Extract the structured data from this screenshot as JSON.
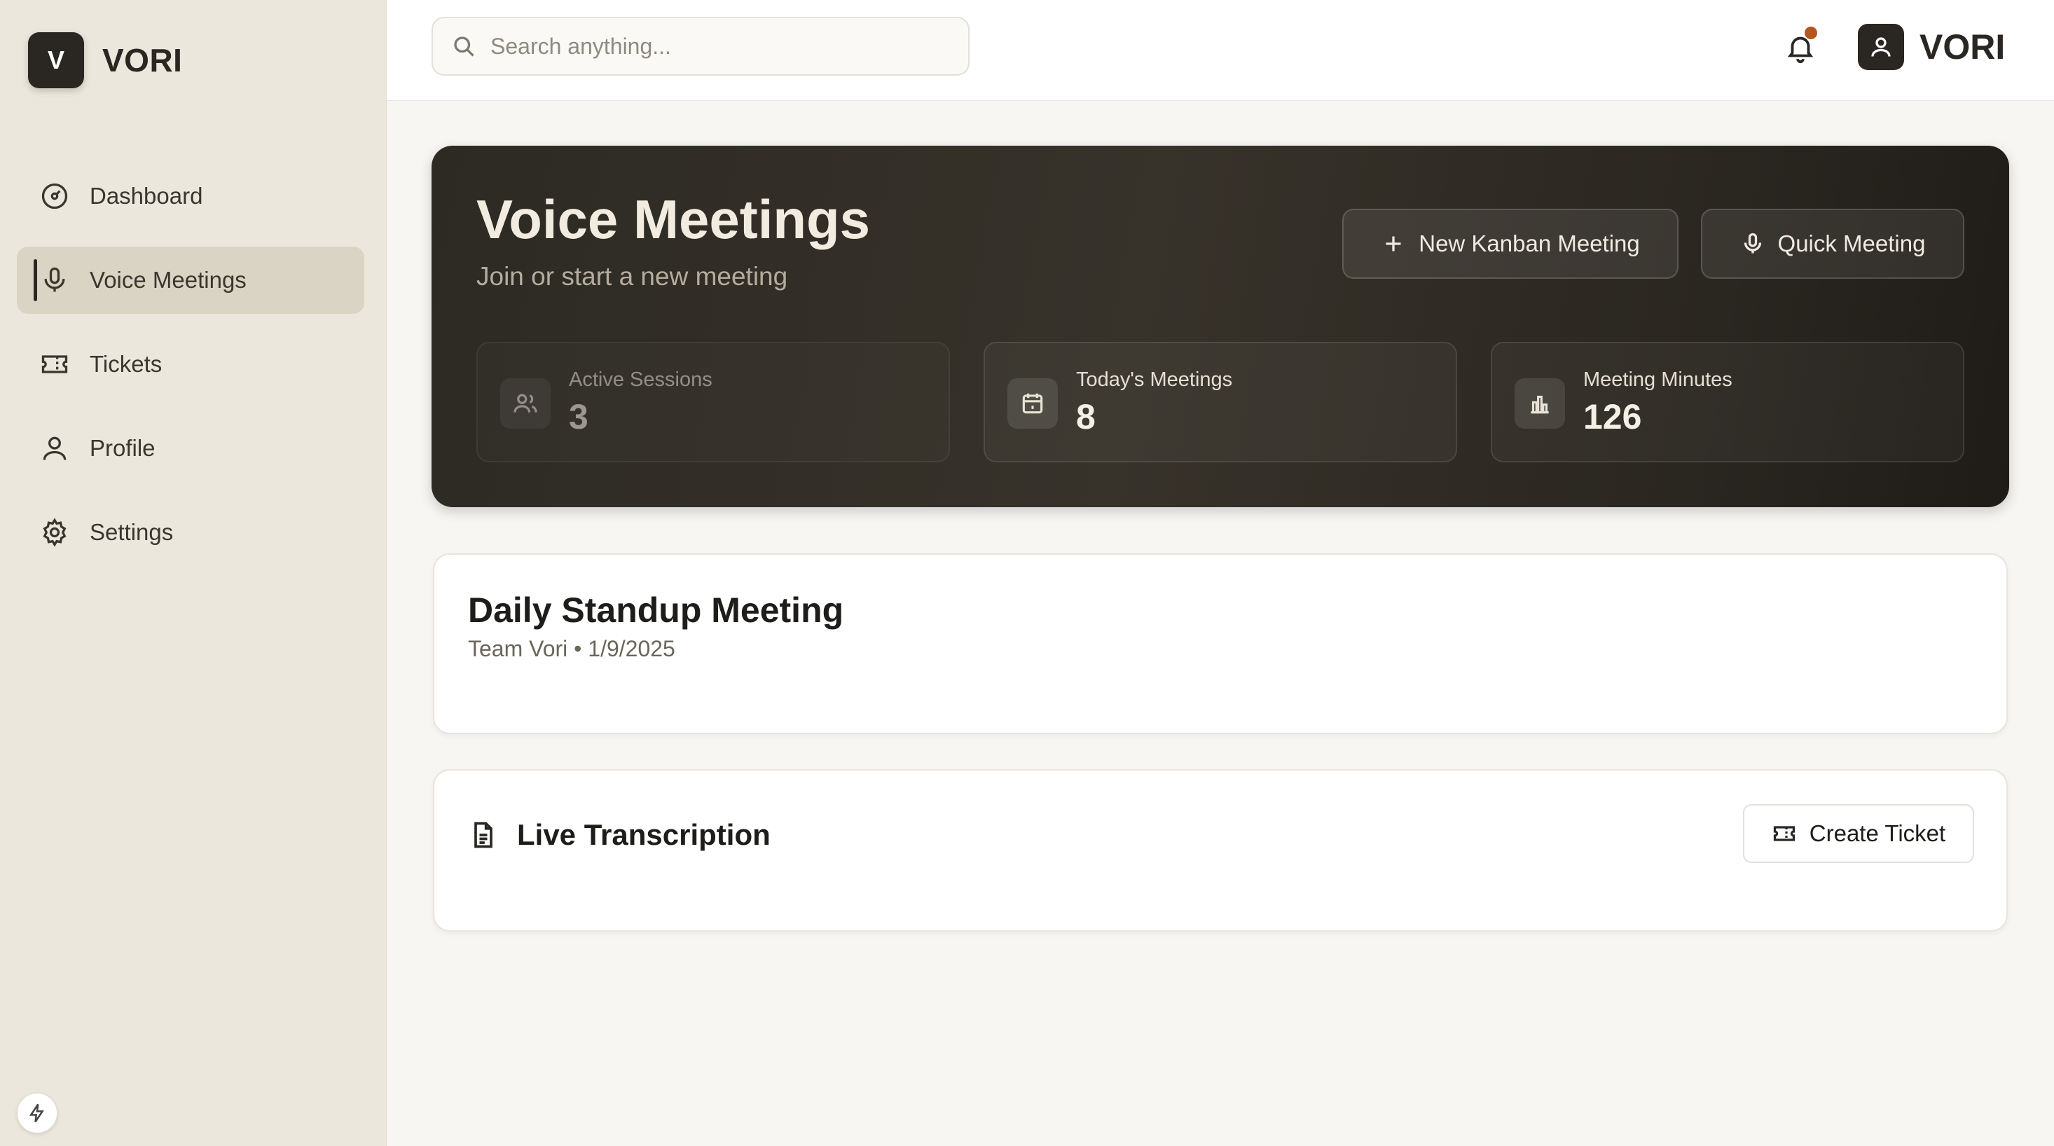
{
  "brand": {
    "initial": "V",
    "name": "VORI"
  },
  "sidebar": {
    "items": [
      {
        "label": "Dashboard",
        "icon": "dashboard-gauge-icon",
        "active": false
      },
      {
        "label": "Voice Meetings",
        "icon": "microphone-icon",
        "active": true
      },
      {
        "label": "Tickets",
        "icon": "ticket-icon",
        "active": false
      },
      {
        "label": "Profile",
        "icon": "user-icon",
        "active": false
      },
      {
        "label": "Settings",
        "icon": "gear-icon",
        "active": false
      }
    ],
    "footer_icon": "bolt-icon"
  },
  "header": {
    "search_placeholder": "Search anything...",
    "notification_icon": "bell-icon",
    "has_unread_notification": true,
    "user_name": "VORI"
  },
  "hero": {
    "title": "Voice Meetings",
    "subtitle": "Join or start a new meeting",
    "new_kanban_label": "New Kanban Meeting",
    "quick_meeting_label": "Quick Meeting",
    "stats": [
      {
        "label": "Active Sessions",
        "value": "3",
        "icon": "users-icon"
      },
      {
        "label": "Today's Meetings",
        "value": "8",
        "icon": "calendar-icon"
      },
      {
        "label": "Meeting Minutes",
        "value": "126",
        "icon": "bar-chart-icon"
      }
    ]
  },
  "meeting": {
    "title": "Daily Standup Meeting",
    "meta": "Team Vori • 1/9/2025"
  },
  "transcription": {
    "title": "Live Transcription",
    "create_ticket_label": "Create Ticket"
  },
  "colors": {
    "accent_dark": "#2a2723",
    "sidebar_bg": "#ebe7dc",
    "notification_dot": "#b5561c"
  }
}
